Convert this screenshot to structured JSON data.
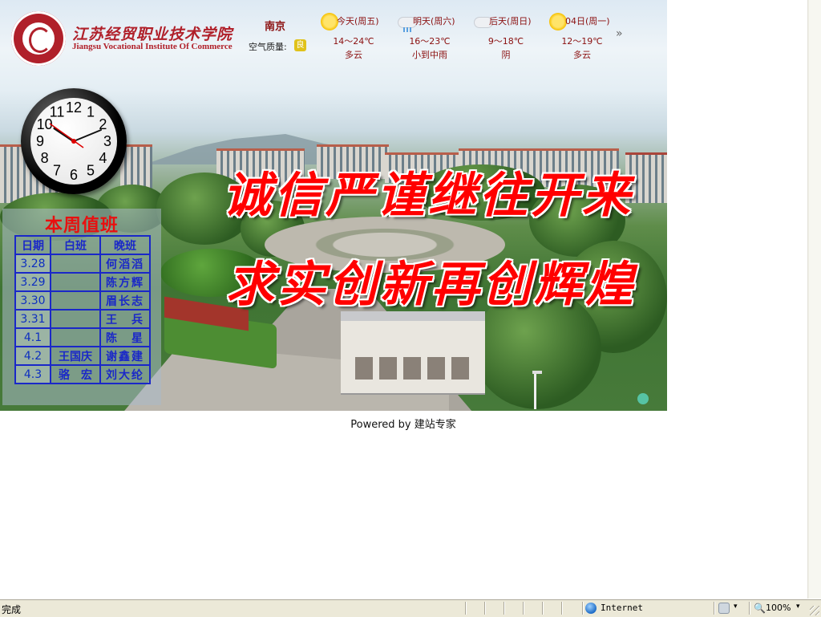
{
  "school": {
    "name_cn": "江苏经贸职业技术学院",
    "name_en": "Jiangsu Vocational Institute Of Commerce"
  },
  "weather": {
    "city": "南京",
    "air_quality_label": "空气质量:",
    "air_quality_value": "良",
    "days": [
      {
        "label": "今天(周五)",
        "temp": "14～24℃",
        "cond": "多云",
        "icon": "sun-cloud-icon"
      },
      {
        "label": "明天(周六)",
        "temp": "16～23℃",
        "cond": "小到中雨",
        "icon": "rain-icon"
      },
      {
        "label": "后天(周日)",
        "temp": "9～18℃",
        "cond": "阴",
        "icon": "cloudy-icon"
      },
      {
        "label": "04日(周一)",
        "temp": "12～19℃",
        "cond": "多云",
        "icon": "sun-cloud-icon"
      }
    ],
    "more": "»"
  },
  "clock": {
    "numbers": [
      "12",
      "1",
      "2",
      "3",
      "4",
      "5",
      "6",
      "7",
      "8",
      "9",
      "10",
      "11"
    ]
  },
  "duty": {
    "title": "本周值班",
    "headers": [
      "日期",
      "白班",
      "晚班"
    ],
    "rows": [
      [
        "3.28",
        "",
        "何滔滔"
      ],
      [
        "3.29",
        "",
        "陈方辉"
      ],
      [
        "3.30",
        "",
        "眉长志"
      ],
      [
        "3.31",
        "",
        "王　兵"
      ],
      [
        "4.1",
        "",
        "陈　星"
      ],
      [
        "4.2",
        "王国庆",
        "谢鑫建"
      ],
      [
        "4.3",
        "骆　宏",
        "刘大纶"
      ]
    ]
  },
  "slogans": {
    "line1": "诚信严谨继往开来",
    "line2": "求实创新再创辉煌"
  },
  "footer": {
    "powered_prefix": "Powered by ",
    "powered_link": "建站专家"
  },
  "statusbar": {
    "status": "完成",
    "zone": "Internet",
    "zoom": "100%"
  },
  "colors": {
    "brand_red": "#b0202a",
    "slogan_red": "#ff0000",
    "duty_blue": "#1a28c8"
  }
}
